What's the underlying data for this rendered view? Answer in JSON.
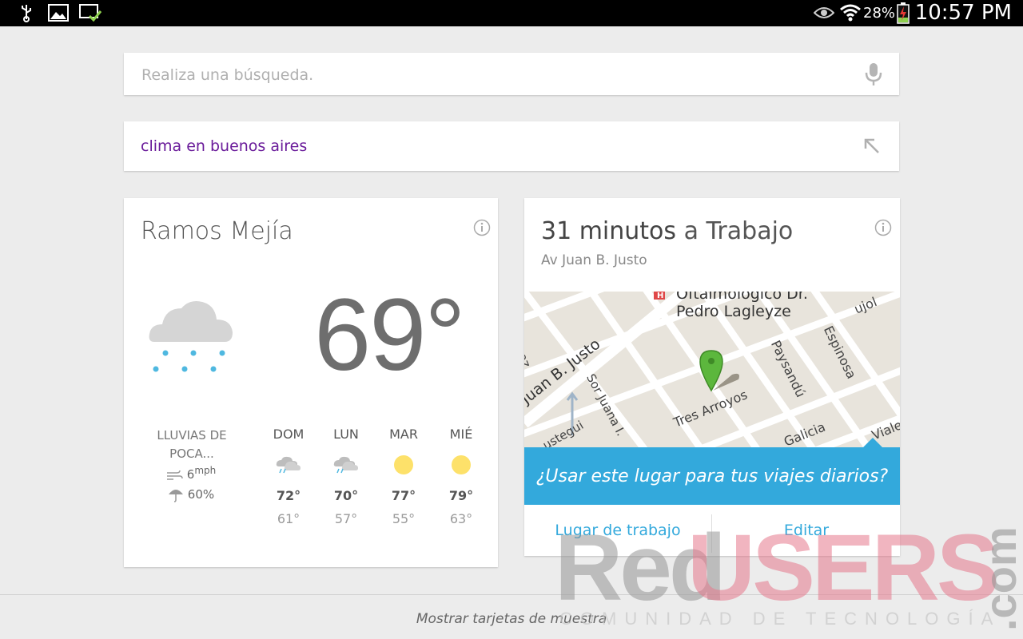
{
  "status_bar": {
    "battery_percent": "28%",
    "time": "10:57 PM",
    "left_icons": [
      "usb-icon",
      "gallery-icon",
      "screen-check-icon"
    ],
    "right_icons": [
      "eye-icon",
      "wifi-icon",
      "battery-charging-icon"
    ]
  },
  "search": {
    "placeholder": "Realiza una búsqueda."
  },
  "recent_query": {
    "text": "clima en buenos aires"
  },
  "weather": {
    "city": "Ramos Mejía",
    "temperature": "69°",
    "condition": "LLUVIAS DE POCA...",
    "wind_value": "6",
    "wind_unit": "mph",
    "rain_chance": "60%",
    "forecast": [
      {
        "day": "DOM",
        "icon": "rain-cloud-icon",
        "high": "72°",
        "low": "61°"
      },
      {
        "day": "LUN",
        "icon": "rain-cloud-icon",
        "high": "70°",
        "low": "57°"
      },
      {
        "day": "MAR",
        "icon": "sun-icon",
        "high": "77°",
        "low": "55°"
      },
      {
        "day": "MIÉ",
        "icon": "sun-icon",
        "high": "79°",
        "low": "63°"
      }
    ]
  },
  "commute": {
    "minutes": "31 minutos",
    "to": "a Trabajo",
    "route": "Av Juan B. Justo",
    "map_labels": {
      "poi_line1": "Oftalmológico Dr.",
      "poi_line2": "Pedro Lagleyze",
      "street1": "Álvarez",
      "street2": "Juan B. Justo",
      "street3": "Sor Juana I.",
      "street4": "Tres Arroyos",
      "street5": "Paysandú",
      "street6": "Espinosa",
      "street7": "Galicia",
      "street8": "ujol",
      "street9": "ustegui",
      "street10": "Viale"
    },
    "prompt": "¿Usar este lugar para tus viajes diarios?",
    "action_work": "Lugar de trabajo",
    "action_edit": "Editar"
  },
  "footer": {
    "link": "Mostrar tarjetas de muestra"
  },
  "watermark": {
    "red": "Red",
    "users": "USERS",
    "com": ".com",
    "tagline": "COMUNIDAD DE TECNOLOGÍA"
  },
  "colors": {
    "accent_blue": "#33a9dc",
    "query_purple": "#6a1b9a",
    "background": "#ececec"
  }
}
